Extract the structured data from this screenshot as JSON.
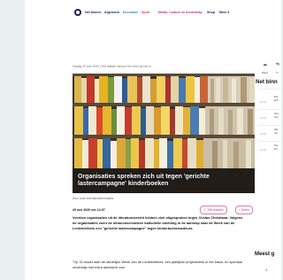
{
  "nav": {
    "items": [
      {
        "label": "Net binnen",
        "color": "#1a1f5c"
      },
      {
        "label": "Algemeen",
        "color": "#1a1f5c"
      },
      {
        "label": "Economie",
        "color": "#2a8ac4"
      },
      {
        "label": "Sport",
        "color": "#e23b3b"
      },
      {
        "label": "Media, Cultuur en Achterklap",
        "color": "#c9347a"
      },
      {
        "label": "Shop",
        "color": "#1a1f5c"
      },
      {
        "label": "Meer",
        "color": "#1a1f5c"
      }
    ]
  },
  "article": {
    "dateline": "Vrijdag 29 mei 2020 | Het laatste nieuws het eerst op NU.nl",
    "hero_title": "Organisaties spreken zich uit tegen 'gerichte lastercampagne' kinderboeken",
    "caption": "Door onze entertainmentredactie",
    "meta_date": "29 mei 2020 om 14:37",
    "reactions_label": "198 reacties",
    "share_label": "Delen",
    "lead": "Veertien organisaties uit de literatuurwereld hebben zich uitgesproken tegen Civitas Christiana. Volgens de organisaties voert de ultraconservatieve katholieke stichting in de aanloop naar de Week van de Lentekriebels een \"gerichte lastercampagne\" tegen kinderboekenauteurs.",
    "body": "\"Op 31 maart start de landelijke Week van de Lentekriebels, een jaarlijkse projectweek in het basis- en speciaal onderwijs met extra aandacht voor"
  },
  "sidebar": {
    "icon1_label": "Weer",
    "icon2_label": "Tr",
    "head": "Net binn",
    "items": [
      {
        "time": "15:01",
        "text": "Eur ach"
      },
      {
        "time": "14:57",
        "text": "Ove ove"
      },
      {
        "time": "14:53",
        "text": "Ola mo"
      },
      {
        "time": "14:49",
        "text": "Tee kin"
      }
    ],
    "head2": "Meest g",
    "num": "1"
  }
}
